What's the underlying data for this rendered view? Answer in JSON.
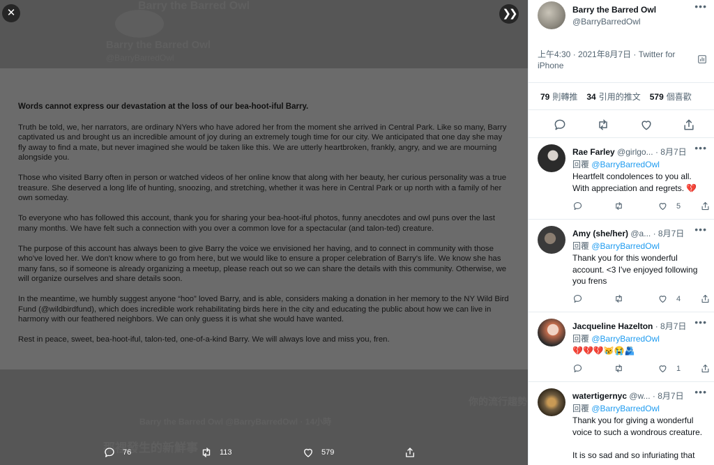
{
  "viewer": {
    "ghost": {
      "name_top": "Barry the Barred Owl",
      "name_mid": "Barry the Barred Owl",
      "handle_mid": "@BarryBarredOwl",
      "reply_line": "Barry the Barred Owl @BarryBarredOwl · 14小時",
      "trending_title": "你的流行趨勢",
      "news_title": "那裡發生的新鮮事"
    },
    "statement": {
      "heading": "Words cannot express our devastation at the loss of our bea-hoot-iful Barry.",
      "paragraphs": [
        "Truth be told, we, her narrators, are ordinary NYers who have adored her from the moment she arrived in Central Park.  Like so many, Barry captivated us and brought us an incredible amount of joy during an extremely tough time for our city.  We anticipated that one day she may fly away to find a mate, but never imagined she would be taken like this.  We are utterly heartbroken, frankly, angry, and we are mourning alongside you.",
        "Those who visited Barry often in person or watched videos of her online know that along with her beauty, her curious personality was a true treasure. She deserved a long life of hunting, snoozing, and stretching, whether it was here in Central Park or up north with a family of her own someday.",
        "To everyone who has followed this account, thank you for sharing your bea-hoot-iful photos, funny anecdotes and owl puns over the last many months. We have felt such a connection with you over a common love for a spectacular (and talon-ted) creature.",
        "The purpose of this account has always been to give Barry the voice we envisioned her having, and to connect in community with those who've loved her.  We don't know where to go from here, but we would like to ensure a proper celebration of Barry's life.  We know she has many fans, so if someone is already organizing a meetup, please reach out so we can share the details with this community.  Otherwise, we will organize ourselves and share details soon.",
        "In the meantime, we humbly suggest anyone “hoo” loved Barry, and is able, considers making a donation in her memory to the NY Wild Bird Fund (@wildbirdfund), which does incredible work rehabilitating birds here in the city and educating the public about how we can live in harmony with our feathered neighbors.  We can only guess it is what she would have wanted.",
        "Rest in peace, sweet, bea-hoot-iful, talon-ted, one-of-a-kind Barry.  We will always love and miss you, fren."
      ]
    },
    "actions": {
      "replies": "76",
      "retweets": "113",
      "likes": "579"
    }
  },
  "tweet": {
    "author_name": "Barry the Barred Owl",
    "author_handle": "@BarryBarredOwl",
    "meta": "上午4:30 · 2021年8月7日 · Twitter for iPhone",
    "stats": [
      {
        "count": "79",
        "label": "則轉推"
      },
      {
        "count": "34",
        "label": "引用的推文"
      },
      {
        "count": "579",
        "label": "個喜歡"
      }
    ]
  },
  "replies": [
    {
      "name": "Rae Farley",
      "handle": "@girlgo...",
      "date": "· 8月7日",
      "replying_prefix": "回覆",
      "replying_to": "@BarryBarredOwl",
      "text": "Heartfelt condolences to you all. With appreciation and regrets. 💔",
      "likes": "5",
      "avatar_color": "#2b2b2b"
    },
    {
      "name": "Amy (she/her)",
      "handle": "@a...",
      "date": "· 8月7日",
      "replying_prefix": "回覆",
      "replying_to": "@BarryBarredOwl",
      "text": "Thank you for this wonderful account. <3 I've enjoyed following you frens",
      "likes": "4",
      "avatar_color": "#3a3a3a"
    },
    {
      "name": "Jacqueline Hazelton",
      "handle": "",
      "date": "· 8月7日",
      "replying_prefix": "回覆",
      "replying_to": "@BarryBarredOwl",
      "text": "💔💔💔😿😭🫂",
      "likes": "1",
      "avatar_color": "#d98a6a"
    },
    {
      "name": "watertigernyc",
      "handle": "@w...",
      "date": "· 8月7日",
      "replying_prefix": "回覆",
      "replying_to": "@BarryBarredOwl",
      "text": "Thank you for giving a wonderful voice to such a wondrous creature.\n\nIt is so sad and so infuriating that",
      "likes": "",
      "avatar_color": "#6d5a3e"
    }
  ],
  "colors": {
    "accent": "#1d9bf0",
    "heart": "#e0245e"
  }
}
